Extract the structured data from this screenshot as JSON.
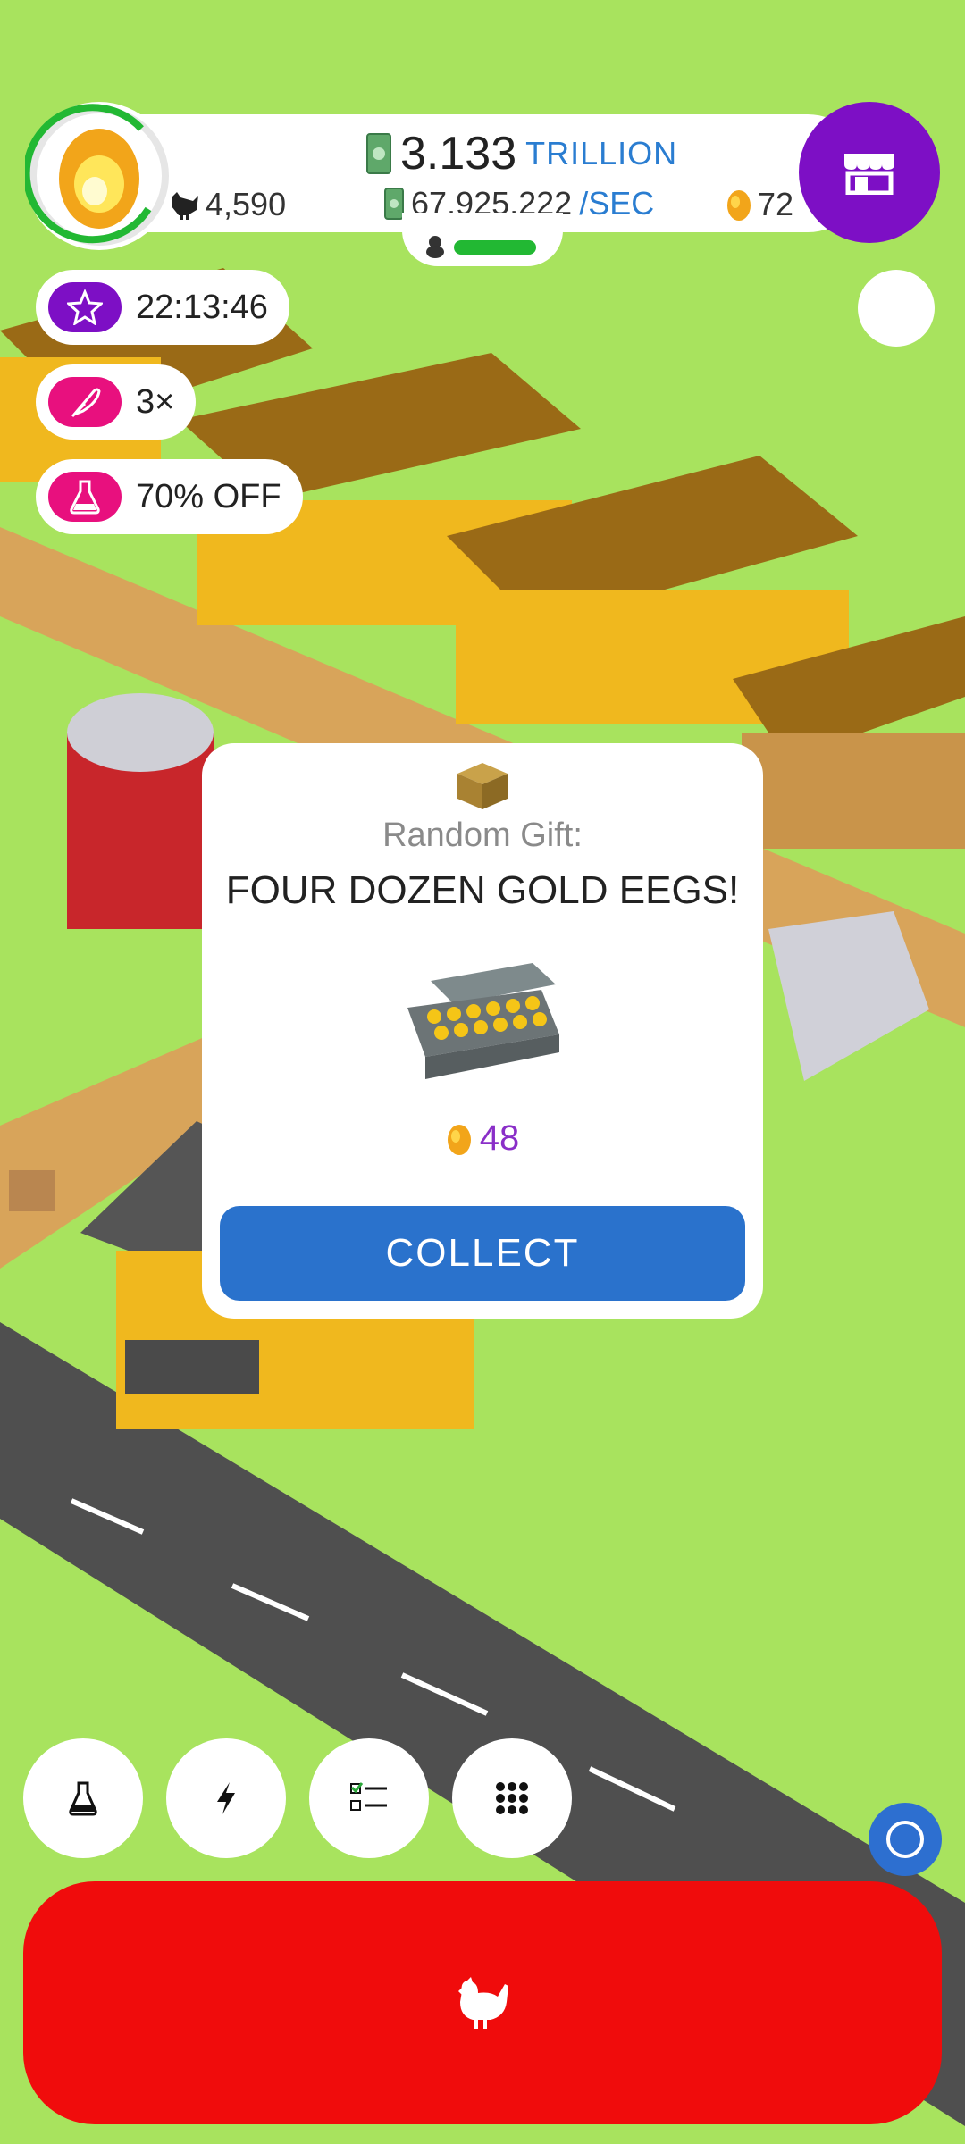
{
  "hud": {
    "cash_value": "3.133",
    "cash_unit": "TRILLION",
    "rate_value": "67,925,222",
    "rate_unit": "/SEC",
    "chickens": "4,590",
    "golden_eggs": "72",
    "hatchery_fill": 1.0
  },
  "boosts": {
    "timer": "22:13:46",
    "multiplier": "3×",
    "discount": "70% OFF"
  },
  "popup": {
    "title": "Random Gift:",
    "description": "FOUR DOZEN GOLD EEGS!",
    "amount": "48",
    "collect_label": "COLLECT"
  },
  "icons": {
    "shop": "shop-icon",
    "star": "star-icon",
    "feather": "feather-icon",
    "flask": "flask-icon",
    "lightning": "lightning-icon",
    "checklist": "checklist-icon",
    "grid": "grid-icon",
    "chicken": "chicken-icon",
    "golden_egg": "golden-egg-icon",
    "gift_box": "gift-box-icon"
  },
  "colors": {
    "grass": "#a8e35e",
    "shop": "#7d0fc5",
    "hatch": "#f00c0c",
    "collect": "#2a72cc",
    "accent_blue": "#2a7dd1",
    "boost_pink": "#e8107e",
    "timer_purple": "#7d0fc5"
  }
}
